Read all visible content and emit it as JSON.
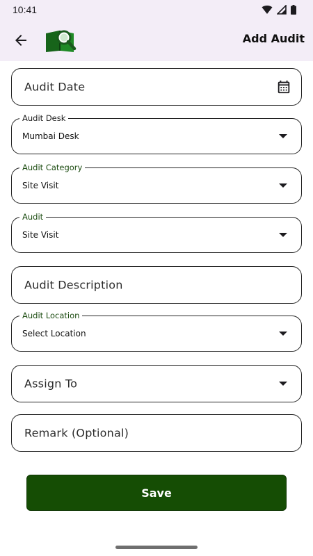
{
  "status_bar": {
    "time": "10:41",
    "icons": [
      "wifi-icon",
      "signal-icon",
      "battery-icon"
    ]
  },
  "app_bar": {
    "title": "Add Audit",
    "back_icon": "back-arrow-icon",
    "logo": "book-search-logo"
  },
  "form": {
    "audit_date": {
      "placeholder": "Audit Date",
      "icon": "calendar-icon"
    },
    "audit_desk": {
      "label": "Audit Desk",
      "value": "Mumbai Desk"
    },
    "audit_category": {
      "label": "Audit Category",
      "value": "Site Visit"
    },
    "audit": {
      "label": "Audit",
      "value": "Site Visit"
    },
    "audit_description": {
      "placeholder": "Audit Description"
    },
    "audit_location": {
      "label": "Audit Location",
      "value": "Select Location"
    },
    "assign_to": {
      "placeholder": "Assign To"
    },
    "remark": {
      "placeholder": "Remark (Optional)"
    }
  },
  "actions": {
    "save_label": "Save"
  },
  "colors": {
    "primary": "#154d04",
    "label_green": "#1d4d12",
    "app_bar_bg": "#f3edf7"
  }
}
